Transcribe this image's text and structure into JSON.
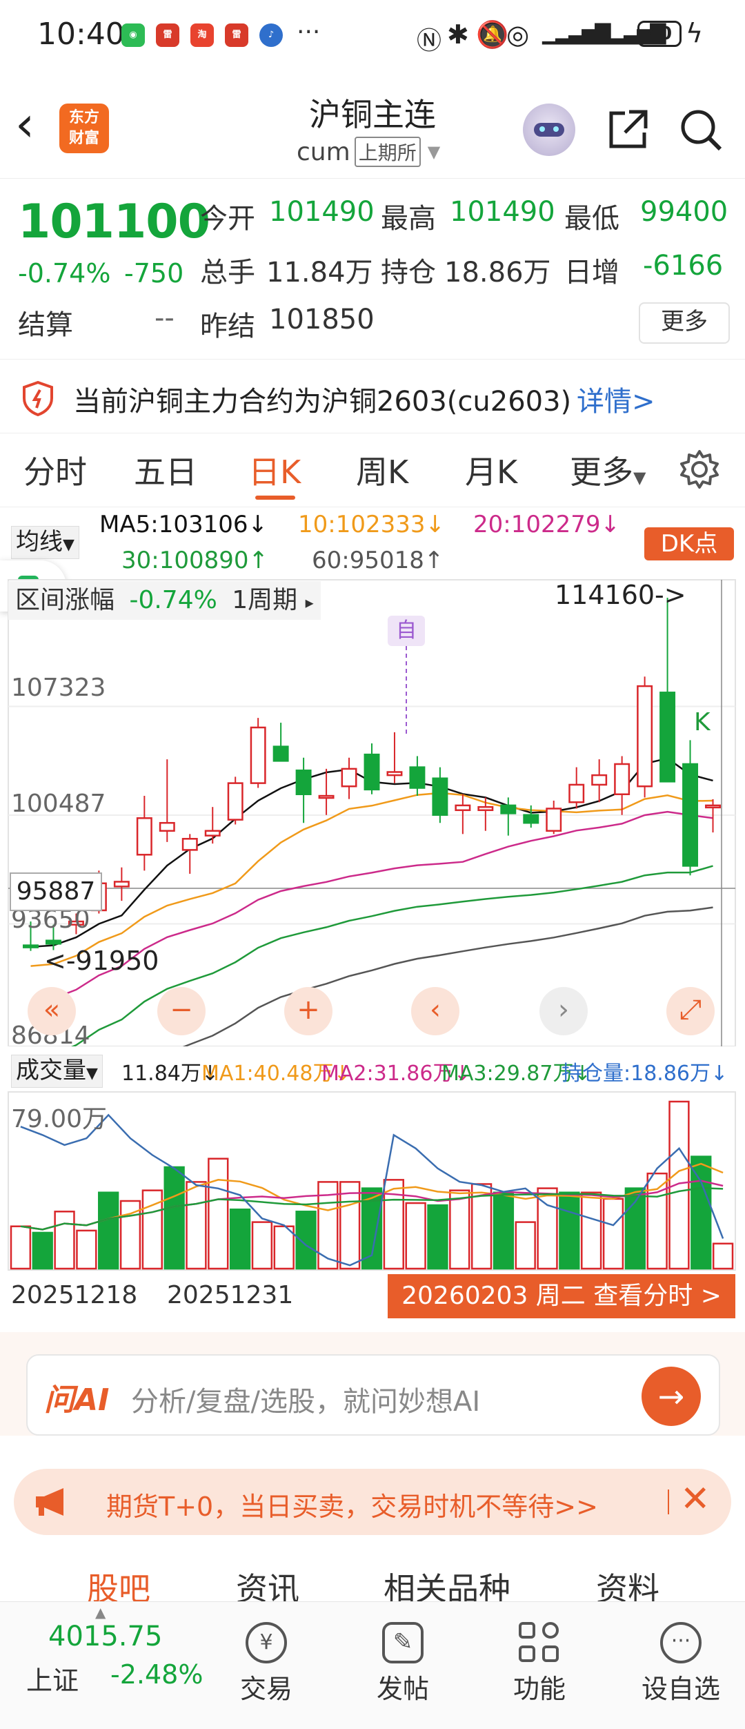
{
  "status_bar": {
    "time": "10:40",
    "more": "···",
    "battery": "40",
    "app_icons": [
      "wechat-icon",
      "leisu-icon",
      "taobao-icon",
      "leisu-icon",
      "music-icon"
    ]
  },
  "header": {
    "title": "沪铜主连",
    "code": "cum",
    "exchange": "上期所",
    "logo_line1": "东方",
    "logo_line2": "财富"
  },
  "quote": {
    "price": "101100",
    "change_pct": "-0.74%",
    "change": "-750",
    "open_label": "今开",
    "open": "101490",
    "high_label": "最高",
    "high": "101490",
    "low_label": "最低",
    "low": "99400",
    "volume_label": "总手",
    "volume": "11.84万",
    "oi_label": "持仓",
    "oi": "18.86万",
    "daily_inc_label": "日增",
    "daily_inc": "-6166",
    "settle_label": "结算",
    "settle": "--",
    "prev_settle_label": "昨结",
    "prev_settle": "101850",
    "more_button": "更多"
  },
  "notice": {
    "text": "当前沪铜主力合约为沪铜2603(cu2603)",
    "link": "详情>"
  },
  "tabs": {
    "items": [
      "分时",
      "五日",
      "日K",
      "周K",
      "月K",
      "更多"
    ],
    "active": "日K"
  },
  "chart": {
    "indicator_select": "均线",
    "ma5": "MA5:103106↓",
    "ma10": "10:102333↓",
    "ma20": "20:102279↓",
    "ma30": "30:100890↑",
    "ma60": "60:95018↑",
    "dk_button": "DK点",
    "range_label": "区间涨幅",
    "range_value": "-0.74%",
    "period": "1周期",
    "high_marker": "114160->",
    "low_marker": "<-91950",
    "self_marker": "自",
    "k_marker": "K",
    "crosshair_value": "95887",
    "y_labels": [
      "107323",
      "100487",
      "93650",
      "86814"
    ],
    "colors": {
      "up": "#d9262a",
      "down": "#14a53b",
      "ma5": "#111111",
      "ma10": "#f09a1a",
      "ma20": "#cc2a8a",
      "ma30": "#1f9a3a",
      "ma60": "#555555"
    }
  },
  "chart_data": {
    "type": "candlestick",
    "title": "",
    "y_range": [
      86814,
      114160
    ],
    "candles": [
      {
        "o": 92300,
        "h": 93800,
        "l": 91950,
        "c": 92200
      },
      {
        "o": 92600,
        "h": 93600,
        "l": 92000,
        "c": 92400
      },
      {
        "o": 93600,
        "h": 94300,
        "l": 93000,
        "c": 93800
      },
      {
        "o": 94500,
        "h": 97000,
        "l": 94300,
        "c": 96200
      },
      {
        "o": 96000,
        "h": 97200,
        "l": 95100,
        "c": 96300
      },
      {
        "o": 98000,
        "h": 101700,
        "l": 97000,
        "c": 100300
      },
      {
        "o": 99500,
        "h": 104000,
        "l": 98800,
        "c": 100000
      },
      {
        "o": 98300,
        "h": 99300,
        "l": 96800,
        "c": 99000
      },
      {
        "o": 99200,
        "h": 101000,
        "l": 98700,
        "c": 99500
      },
      {
        "o": 100200,
        "h": 102900,
        "l": 99900,
        "c": 102500
      },
      {
        "o": 102500,
        "h": 106600,
        "l": 102200,
        "c": 106000
      },
      {
        "o": 104800,
        "h": 106300,
        "l": 104000,
        "c": 103900
      },
      {
        "o": 103300,
        "h": 104100,
        "l": 100000,
        "c": 101800
      },
      {
        "o": 101700,
        "h": 103400,
        "l": 100500,
        "c": 101700
      },
      {
        "o": 102300,
        "h": 104100,
        "l": 101500,
        "c": 103400
      },
      {
        "o": 104300,
        "h": 105000,
        "l": 101800,
        "c": 102100
      },
      {
        "o": 103000,
        "h": 105700,
        "l": 102500,
        "c": 103200
      },
      {
        "o": 103500,
        "h": 104200,
        "l": 101700,
        "c": 102200
      },
      {
        "o": 102800,
        "h": 103500,
        "l": 100000,
        "c": 100500
      },
      {
        "o": 100800,
        "h": 101800,
        "l": 99300,
        "c": 101100
      },
      {
        "o": 100800,
        "h": 101600,
        "l": 99500,
        "c": 101000
      },
      {
        "o": 101100,
        "h": 101600,
        "l": 99200,
        "c": 100600
      },
      {
        "o": 100500,
        "h": 101100,
        "l": 99700,
        "c": 100000
      },
      {
        "o": 99500,
        "h": 101400,
        "l": 99300,
        "c": 100900
      },
      {
        "o": 101300,
        "h": 103500,
        "l": 100900,
        "c": 102400
      },
      {
        "o": 102400,
        "h": 104000,
        "l": 101300,
        "c": 103000
      },
      {
        "o": 101800,
        "h": 104200,
        "l": 100500,
        "c": 103700
      },
      {
        "o": 102300,
        "h": 109200,
        "l": 101600,
        "c": 108600
      },
      {
        "o": 108200,
        "h": 114160,
        "l": 102800,
        "c": 102600
      },
      {
        "o": 103700,
        "h": 105200,
        "l": 96700,
        "c": 97300
      },
      {
        "o": 101100,
        "h": 101490,
        "l": 99400,
        "c": 101100
      }
    ],
    "volume_max": "79.00万",
    "volume_legend": {
      "vol": "11.84万↓",
      "ma1": "MA1:40.48万↓",
      "ma2": "MA2:31.86万↓",
      "ma3": "MA3:29.87万↓",
      "oi": "持仓量:18.86万↓"
    },
    "volume_select": "成交量",
    "volumes": [
      20,
      17,
      27,
      18,
      36,
      32,
      37,
      48,
      41,
      52,
      28,
      22,
      20,
      27,
      41,
      41,
      38,
      42,
      31,
      30,
      37,
      40,
      36,
      22,
      38,
      36,
      36,
      33,
      38,
      45,
      79,
      53,
      11.84
    ],
    "x_labels": [
      "20251218",
      "20251231"
    ],
    "date_button": "20260203 周二 查看分时 >"
  },
  "ai_bar": {
    "logo": "问AI",
    "placeholder": "分析/复盘/选股，就问妙想AI"
  },
  "promo": {
    "text": "期货T+0，当日买卖，交易时机不等待>>"
  },
  "sub_tabs": [
    "股吧",
    "资讯",
    "相关品种",
    "资料"
  ],
  "bottom_nav": {
    "index_value": "4015.75",
    "index_name": "上证",
    "index_change": "-2.48%",
    "items": [
      "交易",
      "发帖",
      "功能",
      "设自选"
    ]
  }
}
